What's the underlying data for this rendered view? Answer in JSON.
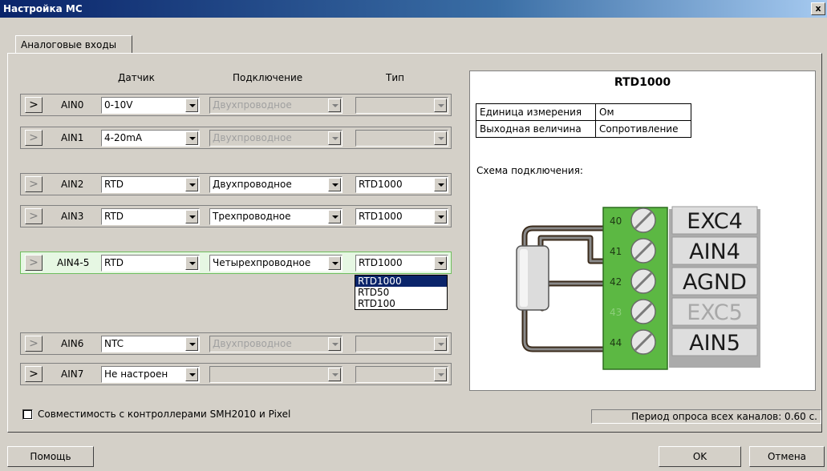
{
  "window": {
    "title": "Настройка МС",
    "close_glyph": "x"
  },
  "tabs": [
    {
      "label": "Аналоговые входы"
    }
  ],
  "columns": {
    "sensor": "Датчик",
    "connection": "Подключение",
    "type": "Тип"
  },
  "rows": [
    {
      "name": "AIN0",
      "sensor": "0-10V",
      "connection": "Двухпроводное",
      "type": ""
    },
    {
      "name": "AIN1",
      "sensor": "4-20mA",
      "connection": "Двухпроводное",
      "type": ""
    },
    {
      "name": "AIN2",
      "sensor": "RTD",
      "connection": "Двухпроводное",
      "type": "RTD1000"
    },
    {
      "name": "AIN3",
      "sensor": "RTD",
      "connection": "Трехпроводное",
      "type": "RTD1000"
    },
    {
      "name": "AIN4-5",
      "sensor": "RTD",
      "connection": "Четырехпроводное",
      "type": "RTD1000"
    },
    {
      "name": "AIN6",
      "sensor": "NTC",
      "connection": "Двухпроводное",
      "type": ""
    },
    {
      "name": "AIN7",
      "sensor": "Не настроен",
      "connection": "",
      "type": ""
    }
  ],
  "row_button_glyph": ">",
  "type_dropdown": {
    "options": [
      "RTD1000",
      "RTD50",
      "RTD100"
    ],
    "highlighted": "RTD1000"
  },
  "info": {
    "title": "RTD1000",
    "props": [
      {
        "key": "Единица измерения",
        "value": "Ом"
      },
      {
        "key": "Выходная величина",
        "value": "Сопротивление"
      }
    ],
    "schema_label": "Схема подключения:",
    "terminals": [
      {
        "num": "40",
        "label": "EXC4",
        "dim": false
      },
      {
        "num": "41",
        "label": "AIN4",
        "dim": false
      },
      {
        "num": "42",
        "label": "AGND",
        "dim": false
      },
      {
        "num": "43",
        "label": "EXC5",
        "dim": true
      },
      {
        "num": "44",
        "label": "AIN5",
        "dim": false
      }
    ]
  },
  "compat_checkbox": {
    "label": "Совместимость с контроллерами SMH2010 и Pixel",
    "checked": false
  },
  "period_text": "Период опроса всех каналов: 0.60 с.",
  "buttons": {
    "help": "Помощь",
    "ok": "OK",
    "cancel": "Отмена"
  },
  "colors": {
    "terminal_green": "#5cb843",
    "title_bar": "#0a246a",
    "selected_row": "#e6f7e3"
  }
}
